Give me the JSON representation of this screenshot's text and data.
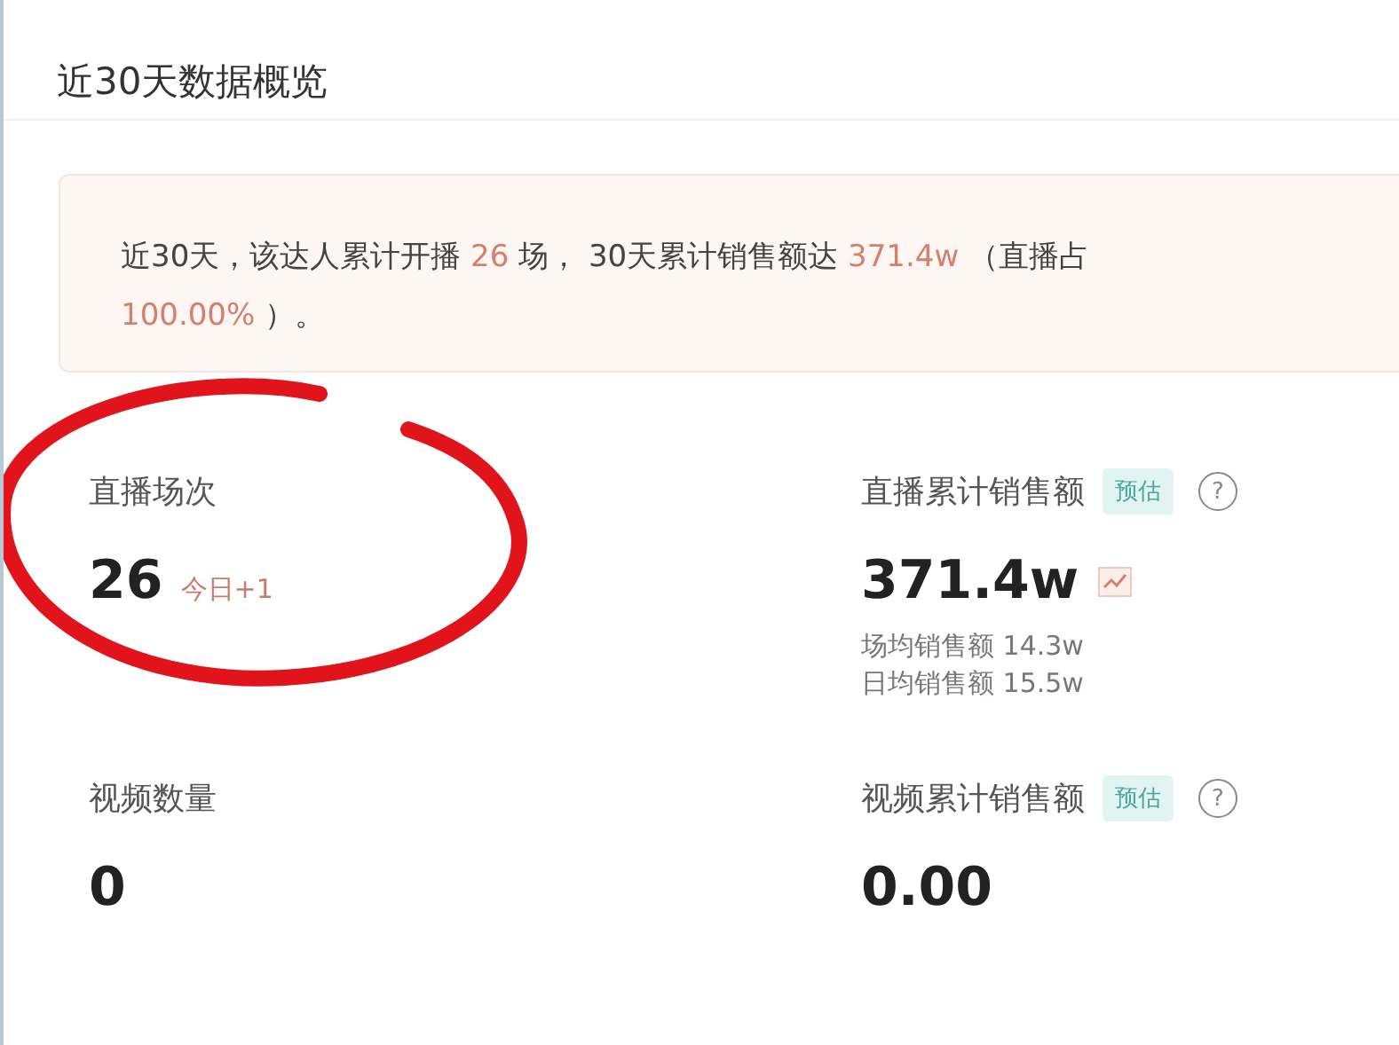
{
  "title": "近30天数据概览",
  "summary": [
    {
      "text": "近30天，该达人累计开播 ",
      "highlight": false
    },
    {
      "text": "26",
      "highlight": true
    },
    {
      "text": " 场， 30天累计销售额达 ",
      "highlight": false
    },
    {
      "text": "371.4w",
      "highlight": true
    },
    {
      "text": " （直播占 ",
      "highlight": false
    },
    {
      "text": "100.00%",
      "highlight": true
    },
    {
      "text": " ）。",
      "highlight": false
    }
  ],
  "metrics": [
    {
      "label": "直播场次",
      "value": "26",
      "today": "今日+1",
      "circled": true
    },
    {
      "label": "直播累计销售额",
      "badge": "预估",
      "help": "?",
      "value": "371.4w",
      "trend": true,
      "details": [
        {
          "label": "场均销售额",
          "value": "14.3w"
        },
        {
          "label": "日均销售额",
          "value": "15.5w"
        }
      ]
    },
    {
      "label": "视频数量",
      "value": "0"
    },
    {
      "label": "视频累计销售额",
      "badge": "预估",
      "help": "?",
      "value": "0.00"
    }
  ]
}
